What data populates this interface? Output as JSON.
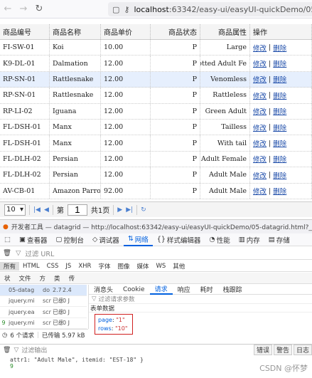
{
  "browser": {
    "back_icon": "arrow-left-icon",
    "forward_icon": "arrow-right-icon",
    "reload_icon": "reload-icon",
    "url_host": "localhost",
    "url_rest": ":63342/easy-ui/easyUI-quickDemo/05-dat"
  },
  "grid": {
    "headers": [
      "商品编号",
      "商品名称",
      "商品单价",
      "商品状态",
      "商品属性",
      "操作"
    ],
    "rows": [
      {
        "id": "FI-SW-01",
        "name": "Koi",
        "price": "10.00",
        "status": "P",
        "attr": "Large",
        "edit": "修改",
        "sep": "|",
        "del": "删除"
      },
      {
        "id": "K9-DL-01",
        "name": "Dalmation",
        "price": "12.00",
        "status": "P",
        "attr": "Spotted Adult Fe",
        "edit": "修改",
        "sep": "|",
        "del": "删除"
      },
      {
        "id": "RP-SN-01",
        "name": "Rattlesnake",
        "price": "12.00",
        "status": "P",
        "attr": "Venomless",
        "edit": "修改",
        "sep": "|",
        "del": "删除"
      },
      {
        "id": "RP-SN-01",
        "name": "Rattlesnake",
        "price": "12.00",
        "status": "P",
        "attr": "Rattleless",
        "edit": "修改",
        "sep": "|",
        "del": "删除"
      },
      {
        "id": "RP-LI-02",
        "name": "Iguana",
        "price": "12.00",
        "status": "P",
        "attr": "Green Adult",
        "edit": "修改",
        "sep": "|",
        "del": "删除"
      },
      {
        "id": "FL-DSH-01",
        "name": "Manx",
        "price": "12.00",
        "status": "P",
        "attr": "Tailless",
        "edit": "修改",
        "sep": "|",
        "del": "删除"
      },
      {
        "id": "FL-DSH-01",
        "name": "Manx",
        "price": "12.00",
        "status": "P",
        "attr": "With tail",
        "edit": "修改",
        "sep": "|",
        "del": "删除"
      },
      {
        "id": "FL-DLH-02",
        "name": "Persian",
        "price": "12.00",
        "status": "P",
        "attr": "Adult Female",
        "edit": "修改",
        "sep": "|",
        "del": "删除"
      },
      {
        "id": "FL-DLH-02",
        "name": "Persian",
        "price": "12.00",
        "status": "P",
        "attr": "Adult Male",
        "edit": "修改",
        "sep": "|",
        "del": "删除"
      },
      {
        "id": "AV-CB-01",
        "name": "Amazon Parrot",
        "price": "92.00",
        "status": "P",
        "attr": "Adult Male",
        "edit": "修改",
        "sep": "|",
        "del": "删除"
      }
    ],
    "selected_row": 2
  },
  "pager": {
    "page_size": "10",
    "page_label_pre": "第",
    "page_value": "1",
    "page_label_post": "共1页"
  },
  "devtools": {
    "title": "开发者工具 — datagrid — http://localhost:63342/easy-ui/easyUI-quickDemo/05-datagrid.html?_ijt=n5sno",
    "tabs": [
      "查看器",
      "控制台",
      "调试器",
      "网络",
      "样式编辑器",
      "性能",
      "内存",
      "存储"
    ],
    "active_tab": "网络",
    "filter_url": "过滤 URL",
    "type_filters": [
      "所有",
      "HTML",
      "CSS",
      "JS",
      "XHR",
      "字体",
      "图像",
      "媒体",
      "WS",
      "其他"
    ],
    "columns": [
      "状",
      "文件",
      "方",
      "类",
      "传"
    ],
    "detail_tabs": [
      "消息头",
      "Cookie",
      "请求",
      "响应",
      "耗时",
      "栈跟踪"
    ],
    "active_detail_tab": "请求",
    "requests": [
      {
        "status": "",
        "file": "05-datag",
        "method": "do",
        "type": "2.7",
        "size": "2.4"
      },
      {
        "status": "",
        "file": "jquery.mi",
        "method": "scr",
        "type": "已缓",
        "size": "0 J"
      },
      {
        "status": "",
        "file": "jquery.ea",
        "method": "scr",
        "type": "已缓",
        "size": "0 J"
      },
      {
        "status": "9",
        "file": "jquery.mi",
        "method": "scr",
        "type": "已缓",
        "size": "0 J"
      }
    ],
    "filter_params": "过滤请求参数",
    "form_section": "表单数据",
    "form_params": [
      {
        "key": "page",
        "value": "\"1\""
      },
      {
        "key": "rows",
        "value": "\"10\""
      }
    ],
    "status_requests": "6 个请求",
    "status_transfer": "已传输 5.97 kB",
    "console_filter": "过滤输出",
    "console_buttons": [
      "错误",
      "警告",
      "日志"
    ],
    "console_line1": "attr1: \"Adult Male\", itemid: \"EST-18\" }",
    "console_line2": "9"
  },
  "watermark": "CSDN @怀梦"
}
